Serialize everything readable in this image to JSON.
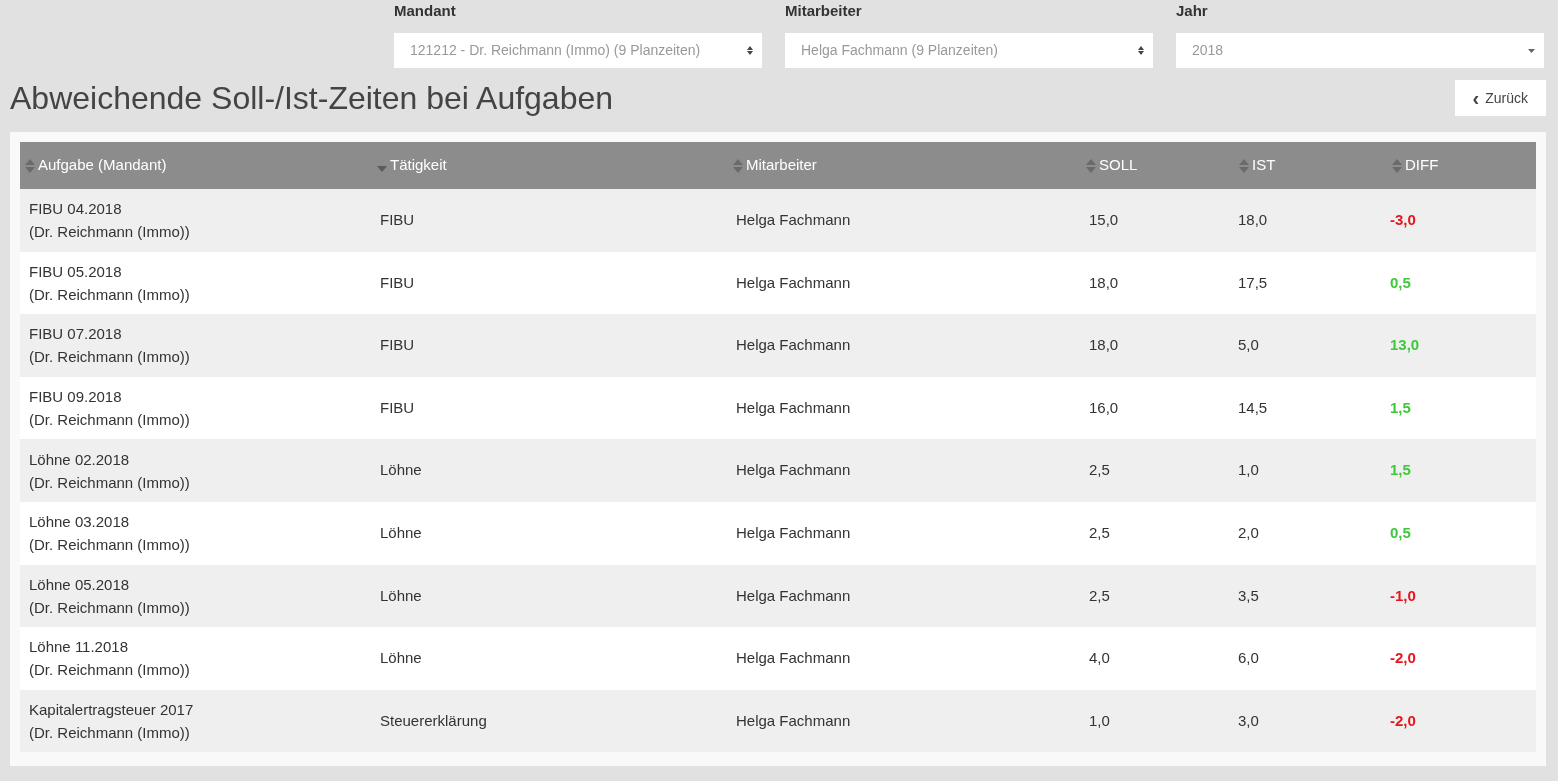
{
  "filters": [
    {
      "label": "Mandant",
      "value": "121212 - Dr. Reichmann (Immo) (9 Planzeiten)",
      "kind": "updown"
    },
    {
      "label": "Mitarbeiter",
      "value": "Helga Fachmann (9 Planzeiten)",
      "kind": "updown"
    },
    {
      "label": "Jahr",
      "value": "2018",
      "kind": "down"
    }
  ],
  "title": "Abweichende Soll-/Ist-Zeiten bei Aufgaben",
  "back_button": {
    "icon": "‹",
    "label": "Zurück"
  },
  "table": {
    "columns": [
      {
        "label": "Aufgabe (Mandant)",
        "sorted": false
      },
      {
        "label": "Tätigkeit",
        "sorted": true
      },
      {
        "label": "Mitarbeiter",
        "sorted": false
      },
      {
        "label": "SOLL",
        "sorted": false
      },
      {
        "label": "IST",
        "sorted": false
      },
      {
        "label": "DIFF",
        "sorted": false
      }
    ],
    "rows": [
      {
        "task": "FIBU 04.2018",
        "client": "(Dr. Reichmann (Immo))",
        "activity": "FIBU",
        "employee": "Helga Fachmann",
        "soll": "15,0",
        "ist": "18,0",
        "diff": "-3,0",
        "color": "#e8141b"
      },
      {
        "task": "FIBU 05.2018",
        "client": "(Dr. Reichmann (Immo))",
        "activity": "FIBU",
        "employee": "Helga Fachmann",
        "soll": "18,0",
        "ist": "17,5",
        "diff": "0,5",
        "color": "#3ec93a"
      },
      {
        "task": "FIBU 07.2018",
        "client": "(Dr. Reichmann (Immo))",
        "activity": "FIBU",
        "employee": "Helga Fachmann",
        "soll": "18,0",
        "ist": "5,0",
        "diff": "13,0",
        "color": "#3ec93a"
      },
      {
        "task": "FIBU 09.2018",
        "client": "(Dr. Reichmann (Immo))",
        "activity": "FIBU",
        "employee": "Helga Fachmann",
        "soll": "16,0",
        "ist": "14,5",
        "diff": "1,5",
        "color": "#3ec93a"
      },
      {
        "task": "Löhne 02.2018",
        "client": "(Dr. Reichmann (Immo))",
        "activity": "Löhne",
        "employee": "Helga Fachmann",
        "soll": "2,5",
        "ist": "1,0",
        "diff": "1,5",
        "color": "#3ec93a"
      },
      {
        "task": "Löhne 03.2018",
        "client": "(Dr. Reichmann (Immo))",
        "activity": "Löhne",
        "employee": "Helga Fachmann",
        "soll": "2,5",
        "ist": "2,0",
        "diff": "0,5",
        "color": "#3ec93a"
      },
      {
        "task": "Löhne 05.2018",
        "client": "(Dr. Reichmann (Immo))",
        "activity": "Löhne",
        "employee": "Helga Fachmann",
        "soll": "2,5",
        "ist": "3,5",
        "diff": "-1,0",
        "color": "#e8141b"
      },
      {
        "task": "Löhne 11.2018",
        "client": "(Dr. Reichmann (Immo))",
        "activity": "Löhne",
        "employee": "Helga Fachmann",
        "soll": "4,0",
        "ist": "6,0",
        "diff": "-2,0",
        "color": "#e8141b"
      },
      {
        "task": "Kapitalertragsteuer 2017",
        "client": "(Dr. Reichmann (Immo))",
        "activity": "Steuererklärung",
        "employee": "Helga Fachmann",
        "soll": "1,0",
        "ist": "3,0",
        "diff": "-2,0",
        "color": "#e8141b"
      }
    ]
  }
}
